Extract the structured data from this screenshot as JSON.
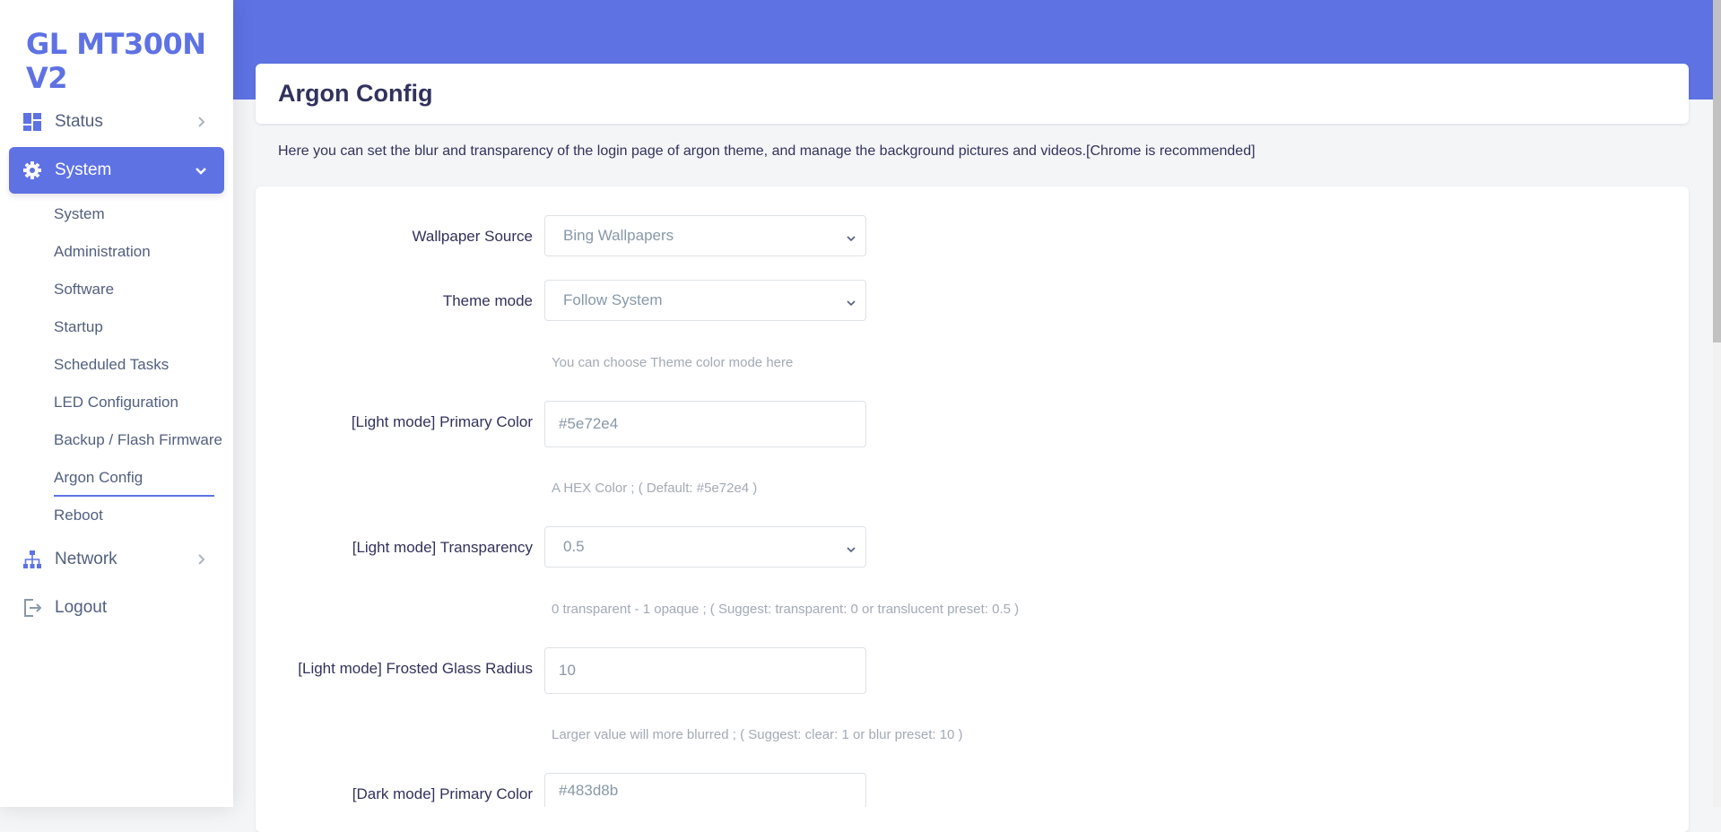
{
  "brand": "GL MT300N V2",
  "nav": {
    "status": "Status",
    "system": "System",
    "network": "Network",
    "logout": "Logout",
    "system_sub": [
      "System",
      "Administration",
      "Software",
      "Startup",
      "Scheduled Tasks",
      "LED Configuration",
      "Backup / Flash Firmware",
      "Argon Config",
      "Reboot"
    ]
  },
  "page": {
    "title": "Argon Config",
    "description": "Here you can set the blur and transparency of the login page of argon theme, and manage the background pictures and videos.[Chrome is recommended]"
  },
  "form": {
    "wallpaper_source": {
      "label": "Wallpaper Source",
      "value": "Bing Wallpapers"
    },
    "theme_mode": {
      "label": "Theme mode",
      "value": "Follow System",
      "hint": "You can choose Theme color mode here"
    },
    "light_primary": {
      "label": "[Light mode] Primary Color",
      "value": "#5e72e4",
      "hint": "A HEX Color ; ( Default: #5e72e4 )"
    },
    "light_transparency": {
      "label": "[Light mode] Transparency",
      "value": "0.5",
      "hint": "0 transparent - 1 opaque ; ( Suggest: transparent: 0 or translucent preset: 0.5 )"
    },
    "light_blur": {
      "label": "[Light mode] Frosted Glass Radius",
      "value": "10",
      "hint": "Larger value will more blurred ; ( Suggest: clear: 1 or blur preset: 10 )"
    },
    "dark_primary": {
      "label": "[Dark mode] Primary Color",
      "value": "#483d8b"
    }
  },
  "colors": {
    "accent": "#5e72e4",
    "text": "#32325d",
    "muted": "#a3aab5"
  }
}
